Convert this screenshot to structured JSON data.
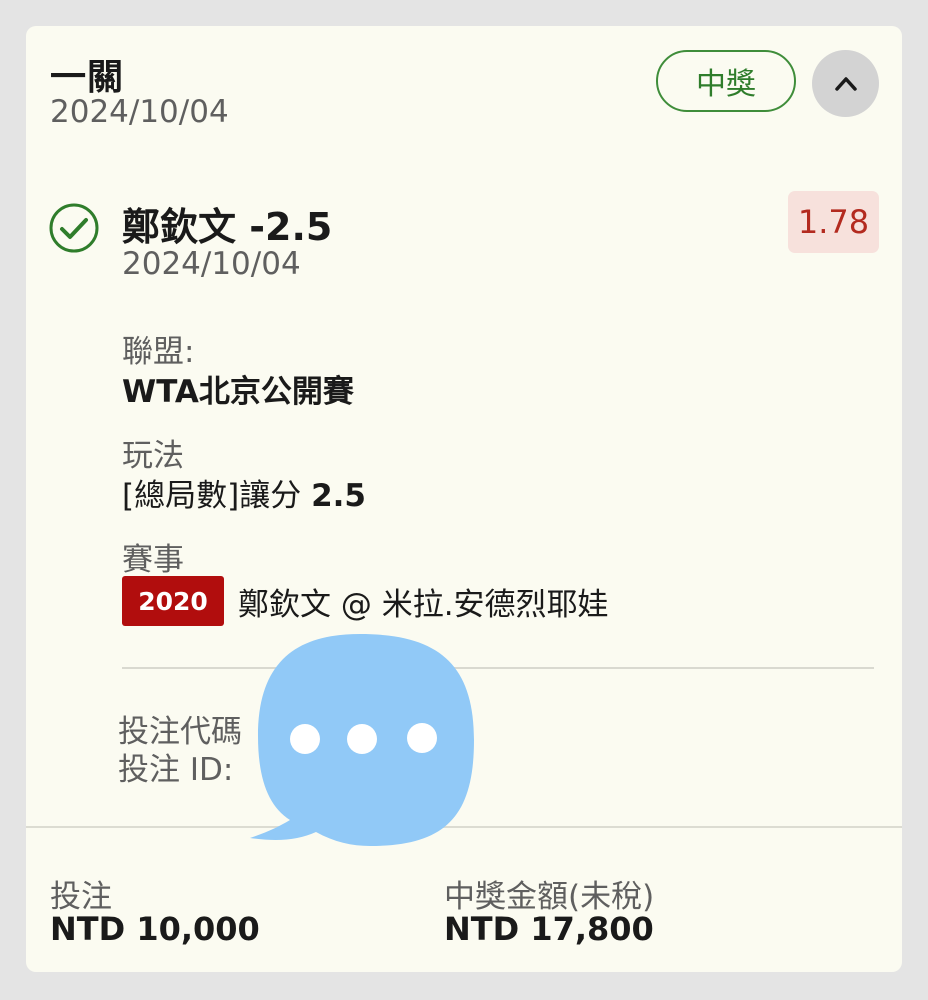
{
  "bet": {
    "type": "一關",
    "date": "2024/10/04",
    "status": "中獎"
  },
  "selection": {
    "name": "鄭欽文 -2.5",
    "date": "2024/10/04",
    "odds": "1.78"
  },
  "details": {
    "league_label": "聯盟:",
    "league_value": "WTA北京公開賽",
    "market_label": "玩法",
    "market_prefix": "[總局數]讓分",
    "market_line": "2.5",
    "event_label": "賽事",
    "event_code": "2020",
    "event_name": "鄭欽文 @ 米拉.安德烈耶娃"
  },
  "reference": {
    "code_label": "投注代碼",
    "id_label": "投注 ID:"
  },
  "footer": {
    "stake_label": "投注",
    "stake_value": "NTD 10,000",
    "payout_label": "中獎金額(未稅)",
    "payout_value": "NTD 17,800"
  },
  "icons": {
    "collapse": "chevron-up-icon",
    "status": "check-circle-icon",
    "overlay": "chat-bubble-icon"
  },
  "colors": {
    "win_green": "#2f7d2b",
    "odds_red": "#b32a1f",
    "event_code_bg": "#b10d0d",
    "chat_blue": "#91c9f7"
  }
}
